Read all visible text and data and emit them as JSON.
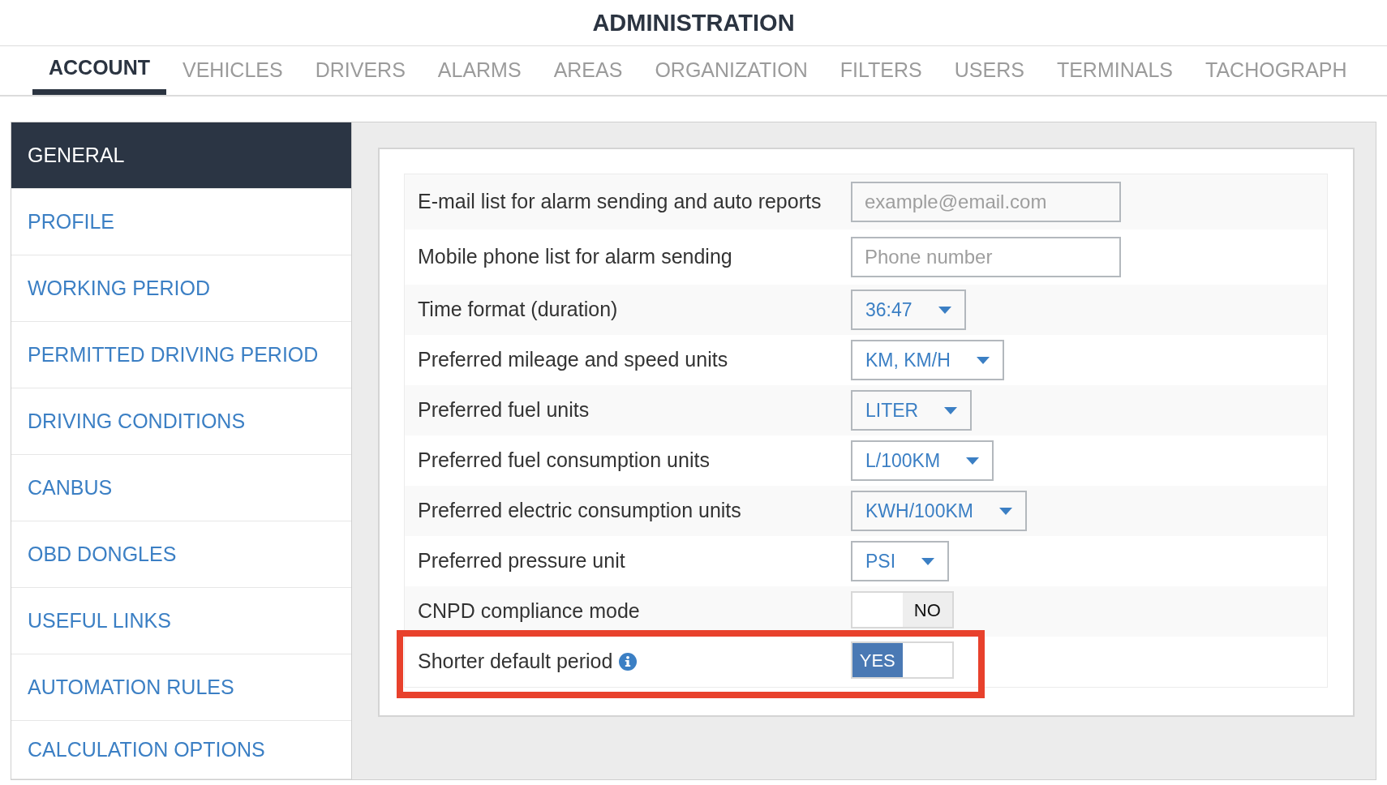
{
  "header": {
    "title": "ADMINISTRATION"
  },
  "tabs": [
    {
      "label": "ACCOUNT",
      "selected": true
    },
    {
      "label": "VEHICLES",
      "selected": false
    },
    {
      "label": "DRIVERS",
      "selected": false
    },
    {
      "label": "ALARMS",
      "selected": false
    },
    {
      "label": "AREAS",
      "selected": false
    },
    {
      "label": "ORGANIZATION",
      "selected": false
    },
    {
      "label": "FILTERS",
      "selected": false
    },
    {
      "label": "USERS",
      "selected": false
    },
    {
      "label": "TERMINALS",
      "selected": false
    },
    {
      "label": "TACHOGRAPH",
      "selected": false
    }
  ],
  "sidebar": {
    "items": [
      {
        "label": "GENERAL",
        "selected": true
      },
      {
        "label": "PROFILE",
        "selected": false
      },
      {
        "label": "WORKING PERIOD",
        "selected": false
      },
      {
        "label": "PERMITTED DRIVING PERIOD",
        "selected": false
      },
      {
        "label": "DRIVING CONDITIONS",
        "selected": false
      },
      {
        "label": "CANBUS",
        "selected": false
      },
      {
        "label": "OBD DONGLES",
        "selected": false
      },
      {
        "label": "USEFUL LINKS",
        "selected": false
      },
      {
        "label": "AUTOMATION RULES",
        "selected": false
      },
      {
        "label": "CALCULATION OPTIONS",
        "selected": false
      }
    ]
  },
  "settings": {
    "rows": [
      {
        "kind": "input",
        "label": "E-mail list for alarm sending and auto reports",
        "placeholder": "example@email.com",
        "info": false,
        "highlighted": false
      },
      {
        "kind": "input",
        "label": "Mobile phone list for alarm sending",
        "placeholder": "Phone number",
        "info": false,
        "highlighted": false
      },
      {
        "kind": "select",
        "label": "Time format (duration)",
        "value": "36:47",
        "info": false,
        "highlighted": false
      },
      {
        "kind": "select",
        "label": "Preferred mileage and speed units",
        "value": "KM, KM/H",
        "info": false,
        "highlighted": false
      },
      {
        "kind": "select",
        "label": "Preferred fuel units",
        "value": "LITER",
        "info": false,
        "highlighted": false
      },
      {
        "kind": "select",
        "label": "Preferred fuel consumption units",
        "value": "L/100KM",
        "info": false,
        "highlighted": false
      },
      {
        "kind": "select",
        "label": "Preferred electric consumption units",
        "value": "KWH/100KM",
        "info": false,
        "highlighted": false
      },
      {
        "kind": "select",
        "label": "Preferred pressure unit",
        "value": "PSI",
        "info": false,
        "highlighted": false
      },
      {
        "kind": "toggle",
        "label": "CNPD compliance mode",
        "on": false,
        "value": "NO",
        "info": false,
        "highlighted": false
      },
      {
        "kind": "toggle",
        "label": "Shorter default period",
        "on": true,
        "value": "YES",
        "info": true,
        "highlighted": true
      }
    ]
  }
}
